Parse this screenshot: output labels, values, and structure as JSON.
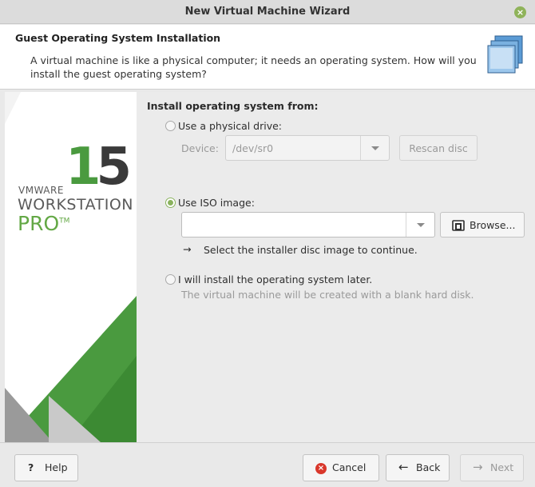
{
  "window": {
    "title": "New Virtual Machine Wizard",
    "title_fragment": "○ · · · · ·",
    "close_icon": "close-icon"
  },
  "header": {
    "title": "Guest Operating System Installation",
    "description": "A virtual machine is like a physical computer; it needs an operating system. How will you install the guest operating system?",
    "icon": "vm-stack-icon"
  },
  "banner": {
    "number_first": "1",
    "number_second": "5",
    "brand_line1": "VMWARE",
    "brand_line2": "WORKSTATION",
    "brand_line3": "PRO",
    "trademark": "TM"
  },
  "install": {
    "section_label": "Install operating system from:",
    "physical": {
      "label": "Use a physical drive:",
      "selected": false,
      "device_label": "Device:",
      "device_value": "/dev/sr0",
      "rescan_label": "Rescan disc"
    },
    "iso": {
      "label": "Use ISO image:",
      "selected": true,
      "path_value": "",
      "browse_label": "Browse...",
      "hint": "Select the installer disc image to continue."
    },
    "later": {
      "label": "I will install the operating system later.",
      "selected": false,
      "hint": "The virtual machine will be created with a blank hard disk."
    }
  },
  "footer": {
    "help_label": "Help",
    "cancel_label": "Cancel",
    "back_label": "Back",
    "next_label": "Next"
  },
  "colors": {
    "accent_green": "#8ab25e",
    "brand_green": "#4a9a3f",
    "cancel_red": "#d9372b"
  }
}
